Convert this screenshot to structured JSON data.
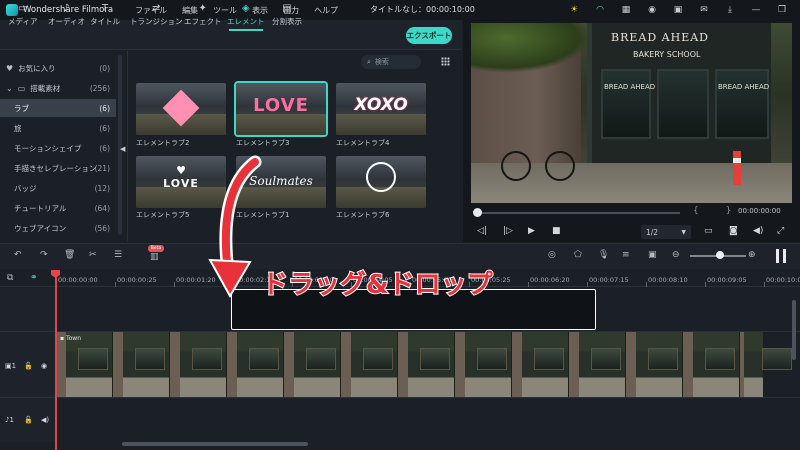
{
  "app": {
    "name": "Wondershare Filmora",
    "doc_title": "タイトルなし：00:00:10:00",
    "menu": [
      "ファイル",
      "編集",
      "ツール",
      "表示",
      "出力",
      "ヘルプ"
    ]
  },
  "tabs": [
    {
      "label": "メディア",
      "icon": "folder-icon"
    },
    {
      "label": "オーディオ",
      "icon": "music-icon"
    },
    {
      "label": "タイトル",
      "icon": "text-icon"
    },
    {
      "label": "トランジション",
      "icon": "transition-icon"
    },
    {
      "label": "エフェクト",
      "icon": "effect-icon"
    },
    {
      "label": "エレメント",
      "icon": "element-icon"
    },
    {
      "label": "分割表示",
      "icon": "split-screen-icon"
    }
  ],
  "active_tab": "エレメント",
  "export_label": "エクスポート",
  "sidebar": {
    "items": [
      {
        "label": "お気に入り",
        "count": "(0)",
        "icon": "heart-icon"
      },
      {
        "label": "搭載素材",
        "count": "(256)",
        "icon": "folder-icon"
      },
      {
        "label": "ラブ",
        "count": "(6)",
        "active": true
      },
      {
        "label": "旅",
        "count": "(6)"
      },
      {
        "label": "モーションシェイプ",
        "count": "(6)"
      },
      {
        "label": "手描きセレブレーション",
        "count": "(21)"
      },
      {
        "label": "バッジ",
        "count": "(12)"
      },
      {
        "label": "チュートリアル",
        "count": "(64)"
      },
      {
        "label": "ウェブアイコン",
        "count": "(56)"
      }
    ]
  },
  "library": {
    "search_placeholder": "検索",
    "thumbs": [
      {
        "label": "エレメントラブ2",
        "art": "heart"
      },
      {
        "label": "エレメントラブ3",
        "art": "LOVE",
        "selected": true
      },
      {
        "label": "エレメントラブ4",
        "art": "XOXO"
      },
      {
        "label": "エレメントラブ5",
        "art": "LOVE"
      },
      {
        "label": "エレメントラブ1",
        "art": "Soulmates"
      },
      {
        "label": "エレメントラブ6",
        "art": "badge"
      }
    ]
  },
  "preview": {
    "sign_main": "BREAD AHEAD",
    "sign_sub": "BAKERY SCHOOL",
    "sign_left": "BREAD AHEAD",
    "sign_right": "BREAD AHEAD",
    "timecode": "00:00:00:00",
    "ratio": "1/2",
    "progress": 0.0
  },
  "timeline": {
    "ruler": [
      "00:00:00:00",
      "00:00:00:25",
      "00:00:01:20",
      "00:00:02:15",
      "00:00:03:10",
      "00:00:04:05",
      "00:00:05:00",
      "00:00:05:25",
      "00:00:06:20",
      "00:00:07:15",
      "00:00:08:10",
      "00:00:09:05",
      "00:00:10:00"
    ],
    "video_clip_label": "Town",
    "beta_badge": "Beta"
  },
  "annotation": {
    "text": "ドラッグ&ドロップ",
    "color": "#e8313a"
  },
  "colors": {
    "accent": "#3ed8c8",
    "playhead": "#e8424a"
  }
}
